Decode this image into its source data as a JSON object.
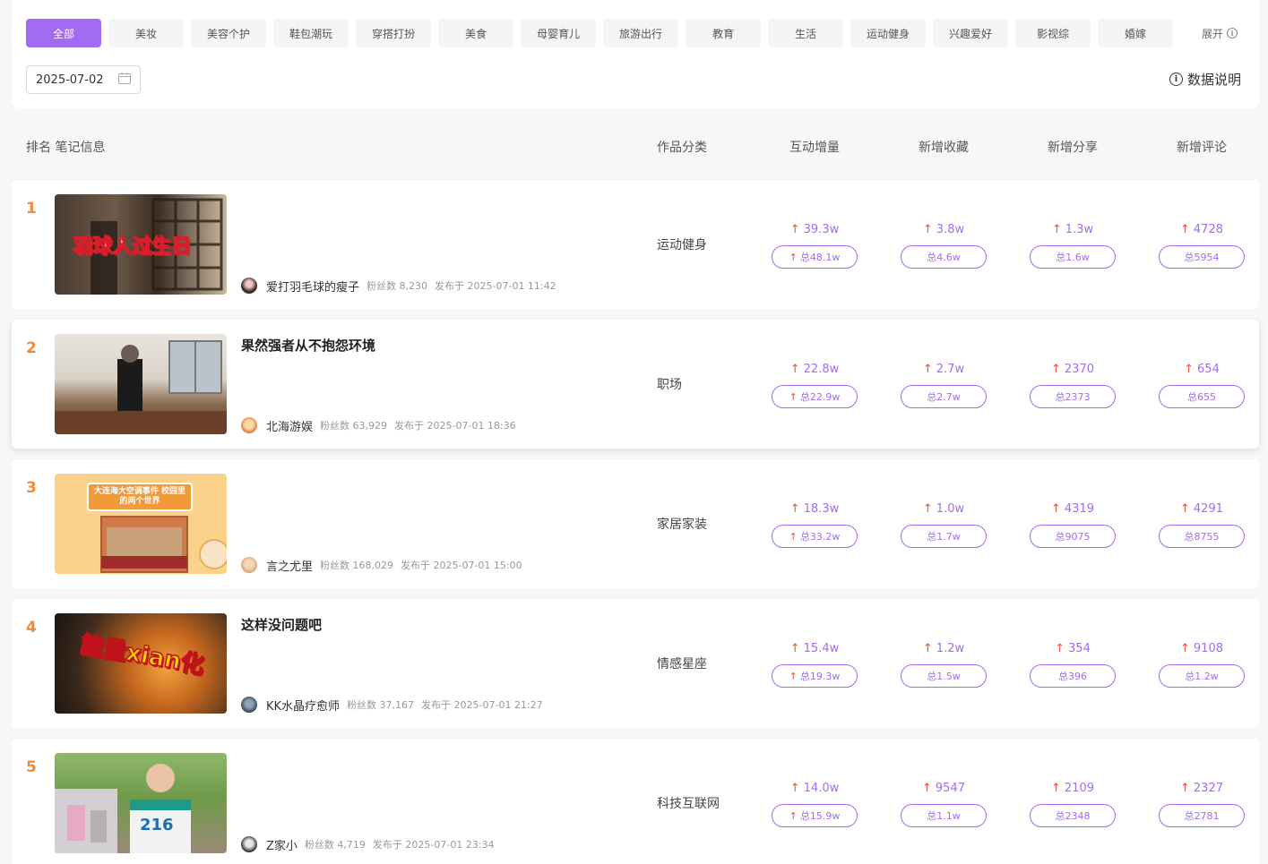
{
  "filters": {
    "categories": [
      "全部",
      "美妆",
      "美容个护",
      "鞋包潮玩",
      "穿搭打扮",
      "美食",
      "母婴育儿",
      "旅游出行",
      "教育",
      "生活",
      "运动健身",
      "兴趣爱好",
      "影视综",
      "婚嫁"
    ],
    "active_index": 0,
    "expand_label": "展开",
    "date_value": "2025-07-02",
    "data_desc_label": "数据说明"
  },
  "columns": {
    "rank_note": "排名 笔记信息",
    "category": "作品分类",
    "interaction": "互动增量",
    "collect": "新增收藏",
    "share": "新增分享",
    "comment": "新增评论"
  },
  "labels": {
    "fans_prefix": "粉丝数",
    "publish_prefix": "发布于"
  },
  "rows": [
    {
      "rank": "1",
      "thumb_text": "羽球人过生日",
      "title": "",
      "author": "爱打羽毛球的瘦子",
      "fans": "粉丝数 8,230",
      "published": "发布于 2025-07-01 11:42",
      "category": "运动健身",
      "interaction": {
        "inc": "39.3w",
        "total": "总48.1w",
        "total_arrow": true
      },
      "collect": {
        "inc": "3.8w",
        "total": "总4.6w",
        "total_arrow": false
      },
      "share": {
        "inc": "1.3w",
        "total": "总1.6w",
        "total_arrow": false
      },
      "comment": {
        "inc": "4728",
        "total": "总5954",
        "total_arrow": false
      }
    },
    {
      "rank": "2",
      "thumb_text": "",
      "title": "果然强者从不抱怨环境",
      "author": "北海游娱",
      "fans": "粉丝数 63,929",
      "published": "发布于 2025-07-01 18:36",
      "category": "职场",
      "interaction": {
        "inc": "22.8w",
        "total": "总22.9w",
        "total_arrow": true
      },
      "collect": {
        "inc": "2.7w",
        "total": "总2.7w",
        "total_arrow": false
      },
      "share": {
        "inc": "2370",
        "total": "总2373",
        "total_arrow": false
      },
      "comment": {
        "inc": "654",
        "total": "总655",
        "total_arrow": false
      }
    },
    {
      "rank": "3",
      "thumb_text": "大连海大空调事件 校园里的两个世界",
      "title": "",
      "author": "言之尤里",
      "fans": "粉丝数 168,029",
      "published": "发布于 2025-07-01 15:00",
      "category": "家居家装",
      "interaction": {
        "inc": "18.3w",
        "total": "总33.2w",
        "total_arrow": true
      },
      "collect": {
        "inc": "1.0w",
        "total": "总1.7w",
        "total_arrow": false
      },
      "share": {
        "inc": "4319",
        "total": "总9075",
        "total_arrow": false
      },
      "comment": {
        "inc": "4291",
        "total": "总8755",
        "total_arrow": false
      }
    },
    {
      "rank": "4",
      "thumb_text": "能量xian化",
      "title": "这样没问题吧",
      "author": "KK水晶疗愈师",
      "fans": "粉丝数 37,167",
      "published": "发布于 2025-07-01 21:27",
      "category": "情感星座",
      "interaction": {
        "inc": "15.4w",
        "total": "总19.3w",
        "total_arrow": true
      },
      "collect": {
        "inc": "1.2w",
        "total": "总1.5w",
        "total_arrow": false
      },
      "share": {
        "inc": "354",
        "total": "总396",
        "total_arrow": false
      },
      "comment": {
        "inc": "9108",
        "total": "总1.2w",
        "total_arrow": false
      }
    },
    {
      "rank": "5",
      "thumb_text": "216",
      "title": "",
      "author": "Z家小",
      "fans": "粉丝数 4,719",
      "published": "发布于 2025-07-01 23:34",
      "category": "科技互联网",
      "interaction": {
        "inc": "14.0w",
        "total": "总15.9w",
        "total_arrow": true
      },
      "collect": {
        "inc": "9547",
        "total": "总1.1w",
        "total_arrow": false
      },
      "share": {
        "inc": "2109",
        "total": "总2348",
        "total_arrow": false
      },
      "comment": {
        "inc": "2327",
        "total": "总2781",
        "total_arrow": false
      }
    }
  ],
  "colors": {
    "accent": "#a36cf0",
    "rank": "#f08a3c",
    "up_arrow": "#e5553b"
  }
}
